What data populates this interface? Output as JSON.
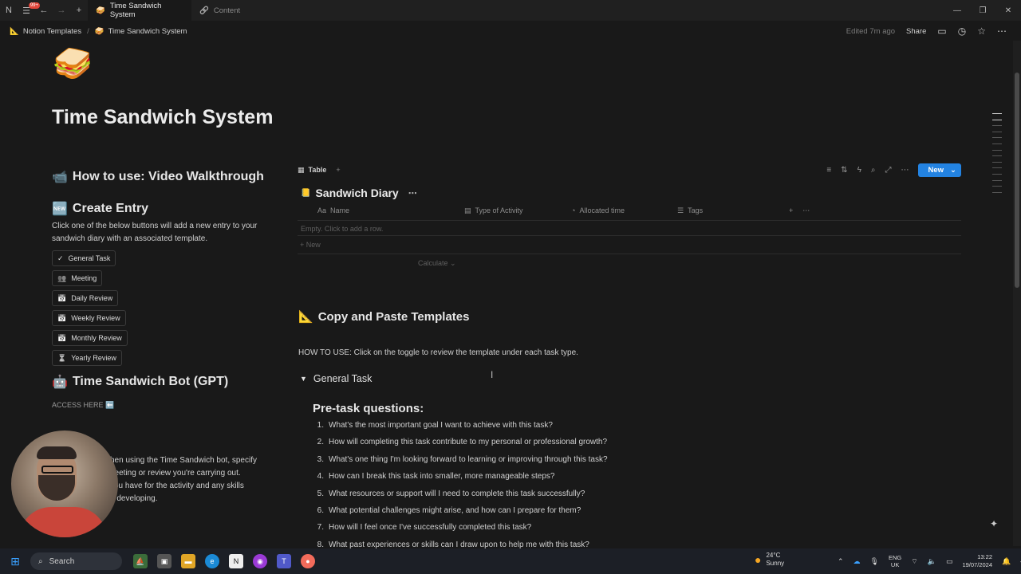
{
  "titlebar": {
    "notif_badge": "99+",
    "tabs": [
      {
        "icon": "🥪",
        "label": "Time Sandwich System"
      },
      {
        "icon": "🔗",
        "label": "Content"
      }
    ]
  },
  "topbar": {
    "breadcrumbs": [
      {
        "icon": "📐",
        "label": "Notion Templates"
      },
      {
        "icon": "🥪",
        "label": "Time Sandwich System"
      }
    ],
    "edited": "Edited 7m ago",
    "share": "Share"
  },
  "page": {
    "emoji": "🥪",
    "title": "Time Sandwich System"
  },
  "left": {
    "video_heading": "How to use: Video Walkthrough",
    "video_icon": "📹",
    "create_heading": "Create Entry",
    "create_icon": "🆕",
    "create_desc": "Click one of the below buttons will add a new entry to your sandwich diary with an associated template.",
    "buttons": [
      {
        "icon": "✓",
        "label": "General Task"
      },
      {
        "icon": "👥",
        "label": "Meeting"
      },
      {
        "icon": "📅",
        "label": "Daily Review"
      },
      {
        "icon": "📅",
        "label": "Weekly Review"
      },
      {
        "icon": "📅",
        "label": "Monthly Review"
      },
      {
        "icon": "⏳",
        "label": "Yearly Review"
      }
    ],
    "bot_heading": "Time Sandwich Bot (GPT)",
    "bot_icon": "🤖",
    "access": "ACCESS HERE ⬅️",
    "bot_desc_lines": [
      "hen using the Time Sandwich bot, specify",
      "neeting or review you're carrying out.",
      "you have for the activity and any skills",
      "n developing."
    ]
  },
  "database": {
    "view_label": "Table",
    "title": "Sandwich Diary",
    "title_icon": "📒",
    "new_label": "New",
    "columns": [
      {
        "icon": "Aa",
        "label": "Name"
      },
      {
        "icon": "▤",
        "label": "Type of Activity"
      },
      {
        "icon": "◔",
        "label": "Allocated time"
      },
      {
        "icon": "☰",
        "label": "Tags"
      }
    ],
    "empty_text": "Empty. Click to add a row.",
    "new_row": "New",
    "calculate": "Calculate"
  },
  "templates": {
    "heading": "Copy and Paste Templates",
    "heading_icon": "📐",
    "howto": "HOW TO USE: Click on the toggle to review the template under each task type.",
    "toggle_label": "General Task",
    "pre_heading": "Pre-task questions:",
    "questions": [
      "What's the most important goal I want to achieve with this task?",
      "How will completing this task contribute to my personal or professional growth?",
      "What's one thing I'm looking forward to learning or improving through this task?",
      "How can I break this task into smaller, more manageable steps?",
      "What resources or support will I need to complete this task successfully?",
      "What potential challenges might arise, and how can I prepare for them?",
      "How will I feel once I've successfully completed this task?",
      "What past experiences or skills can I draw upon to help me with this task?"
    ]
  },
  "taskbar": {
    "search": "Search",
    "weather_temp": "24°C",
    "weather_cond": "Sunny",
    "lang_top": "ENG",
    "lang_bottom": "UK",
    "time": "13:22",
    "date": "19/07/2024"
  }
}
